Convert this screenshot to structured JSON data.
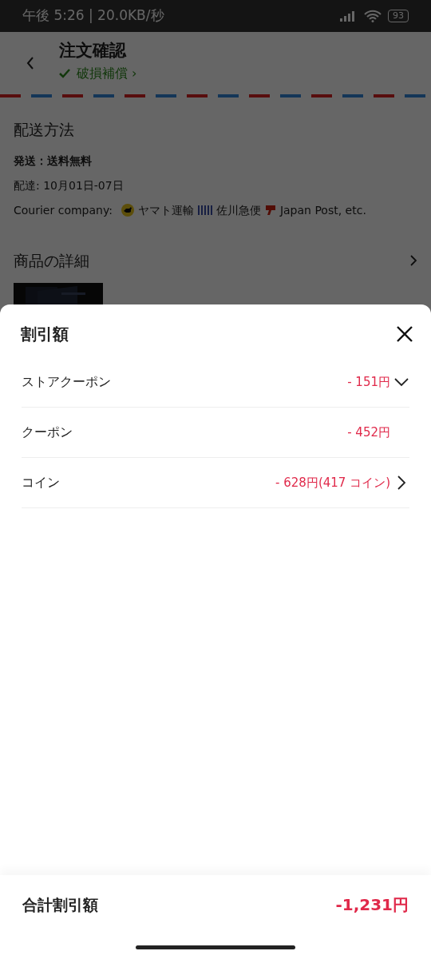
{
  "status_bar": {
    "time": "午後 5:26 | 20.0KB/秒",
    "battery": "93"
  },
  "header": {
    "title": "注文確認",
    "badge": "破損補償 ›"
  },
  "shipping": {
    "title": "配送方法",
    "method": "発送：送料無料",
    "delivery": "配達: 10月01日-07日",
    "courier_label": "Courier company:",
    "couriers": [
      "ヤマト運輸",
      "佐川急便",
      "Japan Post, etc."
    ]
  },
  "product_section": {
    "title": "商品の詳細"
  },
  "sheet": {
    "title": "割引額",
    "rows": [
      {
        "label": "ストアクーポン",
        "amount": "- 151円",
        "kind": "expand"
      },
      {
        "label": "クーポン",
        "amount": "- 452円",
        "kind": "plain"
      },
      {
        "label": "コイン",
        "amount": "- 628円(417 コイン)",
        "kind": "link"
      }
    ],
    "total_label": "合計割引額",
    "total": "-1,231円"
  }
}
